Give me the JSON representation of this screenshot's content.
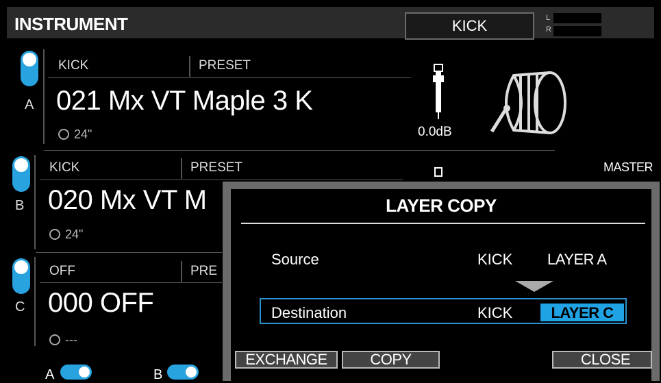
{
  "header": {
    "title": "INSTRUMENT",
    "instrument": "KICK",
    "meter_l": "L",
    "meter_r": "R"
  },
  "layers": [
    {
      "letter": "A",
      "type": "KICK",
      "category": "PRESET",
      "name": "021 Mx VT Maple 3 K",
      "size": "24\"",
      "level": "0.0dB"
    },
    {
      "letter": "B",
      "type": "KICK",
      "category": "PRESET",
      "name": "020 Mx VT M",
      "size": "24\""
    },
    {
      "letter": "C",
      "type": "OFF",
      "category": "PRE",
      "name": "000 OFF",
      "size": "---"
    }
  ],
  "master_label": "MASTER",
  "bottom_toggles": [
    {
      "label": "A"
    },
    {
      "label": "B"
    }
  ],
  "dialog": {
    "title": "LAYER COPY",
    "source": {
      "label": "Source",
      "instrument": "KICK",
      "layer": "LAYER A"
    },
    "destination": {
      "label": "Destination",
      "instrument": "KICK",
      "layer": "LAYER C"
    },
    "buttons": {
      "exchange": "EXCHANGE",
      "copy": "COPY",
      "close": "CLOSE"
    }
  },
  "colors": {
    "accent": "#29a3e0",
    "panel": "#2b2b2b",
    "dialog_frame": "#6b6b6b"
  }
}
